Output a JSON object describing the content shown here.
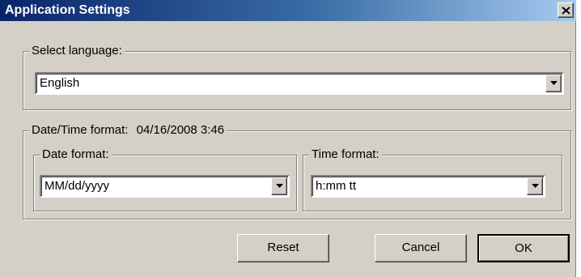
{
  "window": {
    "title": "Application Settings",
    "close_icon": "close-icon"
  },
  "language": {
    "group_label": "Select language:",
    "selected": "English"
  },
  "datetime": {
    "group_label": "Date/Time format:",
    "preview": "04/16/2008 3:46",
    "date_format": {
      "label": "Date format:",
      "selected": "MM/dd/yyyy"
    },
    "time_format": {
      "label": "Time format:",
      "selected": "h:mm tt"
    }
  },
  "buttons": {
    "reset": "Reset",
    "cancel": "Cancel",
    "ok": "OK"
  },
  "colors": {
    "titlebar_start": "#0a246a",
    "titlebar_end": "#a6caf0",
    "face": "#d4d0c8"
  }
}
